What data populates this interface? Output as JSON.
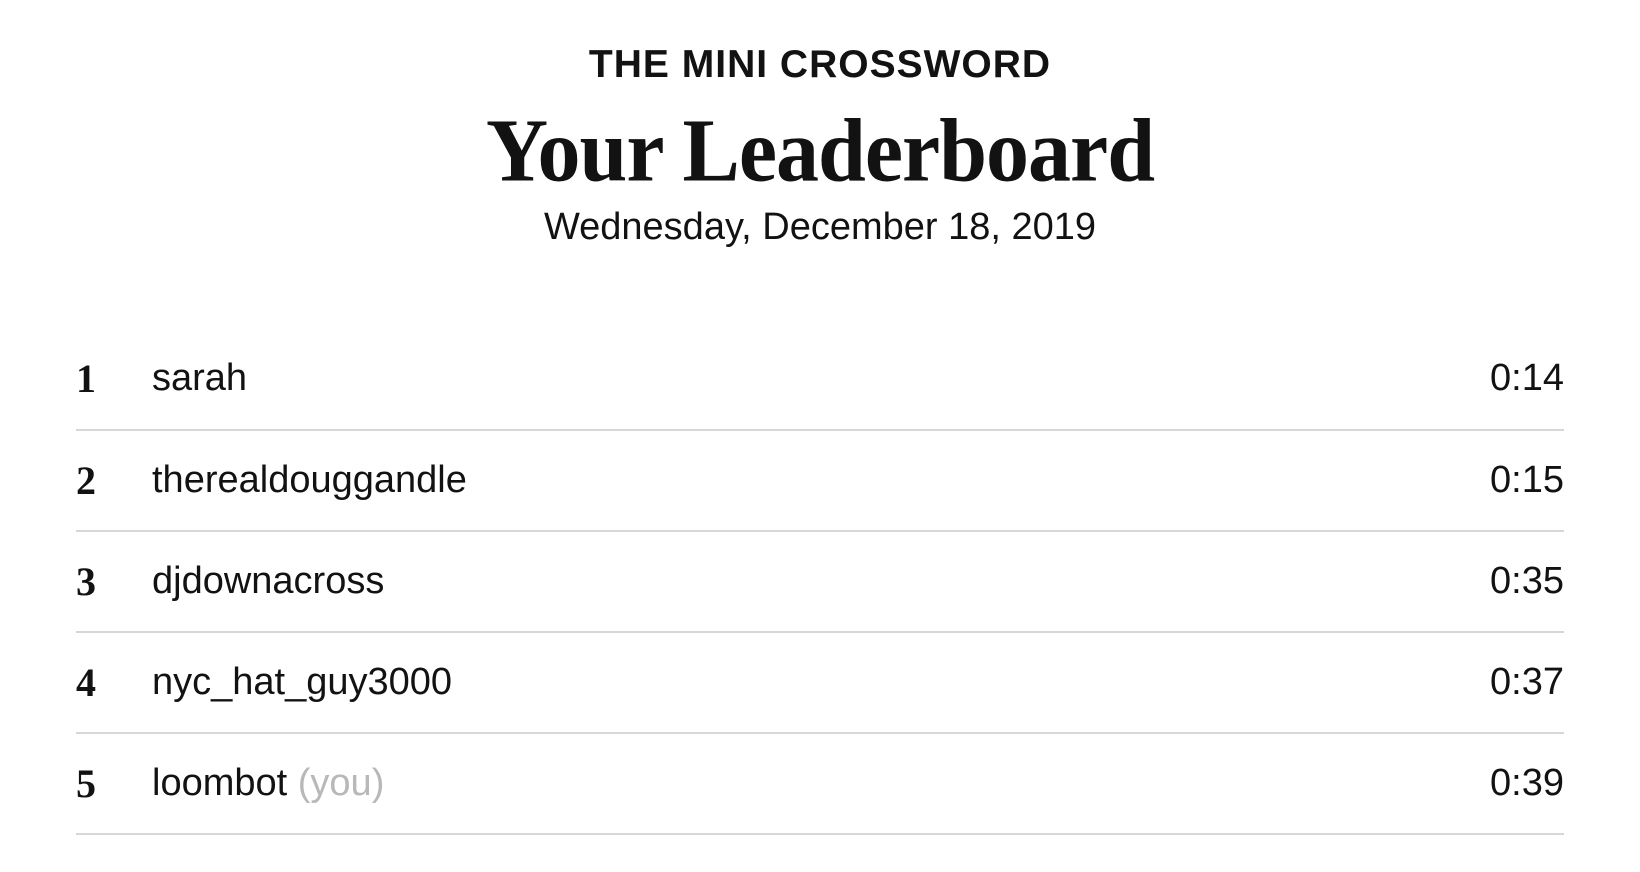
{
  "header": {
    "eyebrow": "THE MINI CROSSWORD",
    "title": "Your Leaderboard",
    "date": "Wednesday, December 18, 2019"
  },
  "leaderboard": {
    "rows": [
      {
        "rank": "1",
        "name": "sarah",
        "tag": "",
        "time": "0:14"
      },
      {
        "rank": "2",
        "name": "therealdouggandle",
        "tag": "",
        "time": "0:15"
      },
      {
        "rank": "3",
        "name": "djdownacross",
        "tag": "",
        "time": "0:35"
      },
      {
        "rank": "4",
        "name": "nyc_hat_guy3000",
        "tag": "",
        "time": "0:37"
      },
      {
        "rank": "5",
        "name": "loombot",
        "tag": "(you)",
        "time": "0:39"
      }
    ]
  }
}
